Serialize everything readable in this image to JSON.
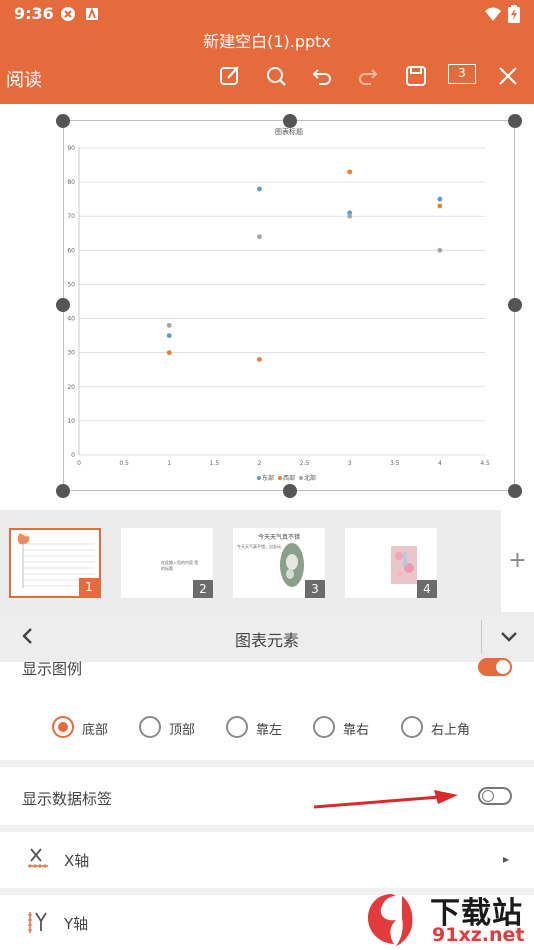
{
  "status_bar": {
    "time": "9:36"
  },
  "toolbar": {
    "doc_title": "新建空白(1).pptx",
    "mode_label": "阅读",
    "page_count": "3"
  },
  "chart_data": {
    "type": "scatter",
    "title": "图表标题",
    "xlim": [
      0,
      4.5
    ],
    "ylim": [
      0,
      90
    ],
    "x_ticks": [
      "0",
      "0.5",
      "1",
      "1.5",
      "2",
      "2.5",
      "3",
      "3.5",
      "4",
      "4.5"
    ],
    "y_ticks": [
      "0",
      "10",
      "20",
      "30",
      "40",
      "50",
      "60",
      "70",
      "80",
      "90"
    ],
    "grid": true,
    "legend_position": "bottom",
    "series": [
      {
        "name": "东部",
        "color": "#5b9bd5",
        "points": [
          [
            1,
            35
          ],
          [
            2,
            78
          ],
          [
            3,
            71
          ],
          [
            4,
            75
          ]
        ]
      },
      {
        "name": "西部",
        "color": "#ed7d31",
        "points": [
          [
            1,
            30
          ],
          [
            2,
            28
          ],
          [
            3,
            83
          ],
          [
            4,
            73
          ]
        ]
      },
      {
        "name": "北部",
        "color": "#a5a5a5",
        "points": [
          [
            1,
            38
          ],
          [
            2,
            64
          ],
          [
            3,
            70
          ],
          [
            4,
            60
          ]
        ]
      }
    ]
  },
  "thumbnails": [
    {
      "num": "1",
      "text": ""
    },
    {
      "num": "2",
      "text": "在此输入您的内容 您的标题"
    },
    {
      "num": "3",
      "text": "今天天气真不错",
      "sub": "今天天气真不错，出去玩"
    },
    {
      "num": "4",
      "text": ""
    }
  ],
  "add_slide": "+",
  "panel": {
    "title": "图表元素",
    "show_legend": "显示图例",
    "legend_positions": [
      "底部",
      "顶部",
      "靠左",
      "靠右",
      "右上角"
    ],
    "show_data_labels": "显示数据标签",
    "x_axis": "X轴",
    "y_axis": "Y轴"
  },
  "watermark": {
    "text": "下载站",
    "domain": "91xz.net"
  },
  "colors": {
    "accent": "#e56a3c",
    "arrow": "#d92a2a"
  }
}
